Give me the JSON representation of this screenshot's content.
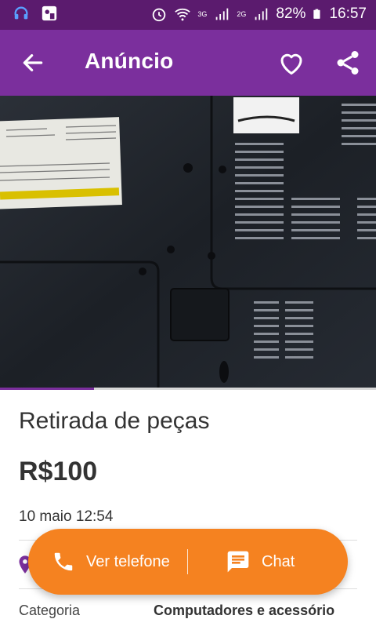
{
  "status_bar": {
    "battery": "82%",
    "time": "16:57",
    "network_1": "3G",
    "network_2": "2G"
  },
  "app_bar": {
    "title": "Anúncio"
  },
  "ad": {
    "title": "Retirada de peças",
    "price": "R$100",
    "date": "10 maio 12:54",
    "category_label": "Categoria",
    "category_value": "Computadores e acessório"
  },
  "actions": {
    "phone_label": "Ver telefone",
    "chat_label": "Chat"
  },
  "photo": {
    "sticker_text": "PRODUZIDO NO PÓLO INDUSTRIAL DE MANAUS"
  },
  "colors": {
    "status_bar": "#5b1b6e",
    "app_bar": "#7b2f9d",
    "action_orange": "#f58220",
    "location_purple": "#7b2f9d"
  },
  "icons": {
    "back": "arrow-left-icon",
    "favorite": "heart-icon",
    "share": "share-icon",
    "phone": "phone-icon",
    "chat": "chat-icon",
    "location": "location-pin-icon"
  }
}
